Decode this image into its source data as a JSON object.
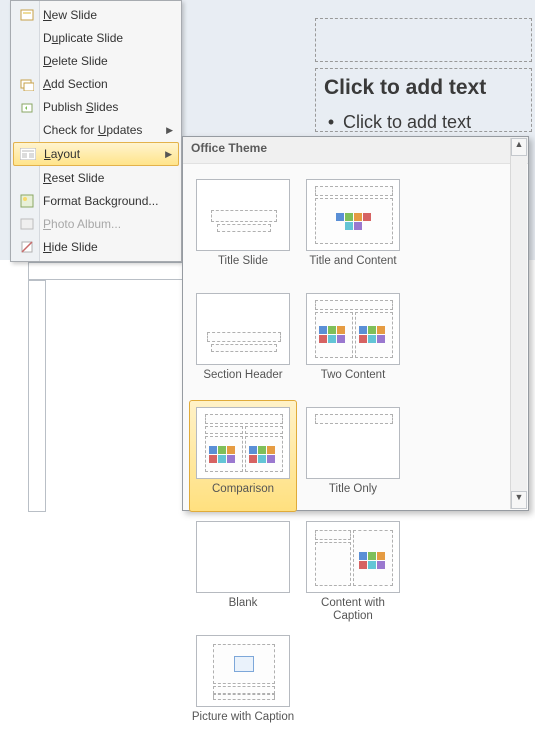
{
  "slide": {
    "title_placeholder": "Click to add text",
    "body_placeholder": "Click to add text"
  },
  "context_menu": {
    "items": [
      {
        "label_pre": "",
        "u": "N",
        "label_post": "ew Slide",
        "icon": "new-slide-icon",
        "arrow": false,
        "disabled": false
      },
      {
        "label_pre": "D",
        "u": "u",
        "label_post": "plicate Slide",
        "icon": "",
        "arrow": false,
        "disabled": false
      },
      {
        "label_pre": "",
        "u": "D",
        "label_post": "elete Slide",
        "icon": "",
        "arrow": false,
        "disabled": false
      },
      {
        "label_pre": "",
        "u": "A",
        "label_post": "dd Section",
        "icon": "add-section-icon",
        "arrow": false,
        "disabled": false
      },
      {
        "label_pre": "Publish ",
        "u": "S",
        "label_post": "lides",
        "icon": "publish-icon",
        "arrow": false,
        "disabled": false
      },
      {
        "label_pre": "Check for ",
        "u": "U",
        "label_post": "pdates",
        "icon": "",
        "arrow": true,
        "disabled": false
      },
      {
        "label_pre": "",
        "u": "L",
        "label_post": "ayout",
        "icon": "layout-icon",
        "arrow": true,
        "disabled": false,
        "hover": true
      },
      {
        "label_pre": "",
        "u": "R",
        "label_post": "eset Slide",
        "icon": "",
        "arrow": false,
        "disabled": false
      },
      {
        "label_pre": "Format Back",
        "u": "g",
        "label_post": "round...",
        "icon": "format-bg-icon",
        "arrow": false,
        "disabled": false
      },
      {
        "label_pre": "",
        "u": "P",
        "label_post": "hoto Album...",
        "icon": "photo-album-icon",
        "arrow": false,
        "disabled": true
      },
      {
        "label_pre": "",
        "u": "H",
        "label_post": "ide Slide",
        "icon": "hide-slide-icon",
        "arrow": false,
        "disabled": false
      }
    ]
  },
  "layout_flyout": {
    "header": "Office Theme",
    "items": [
      {
        "name": "Title Slide",
        "selected": false
      },
      {
        "name": "Title and Content",
        "selected": false
      },
      {
        "name": "Section Header",
        "selected": false
      },
      {
        "name": "Two Content",
        "selected": false
      },
      {
        "name": "Comparison",
        "selected": true
      },
      {
        "name": "Title Only",
        "selected": false
      },
      {
        "name": "Blank",
        "selected": false
      },
      {
        "name": "Content with Caption",
        "selected": false
      },
      {
        "name": "Picture with Caption",
        "selected": false
      }
    ]
  }
}
